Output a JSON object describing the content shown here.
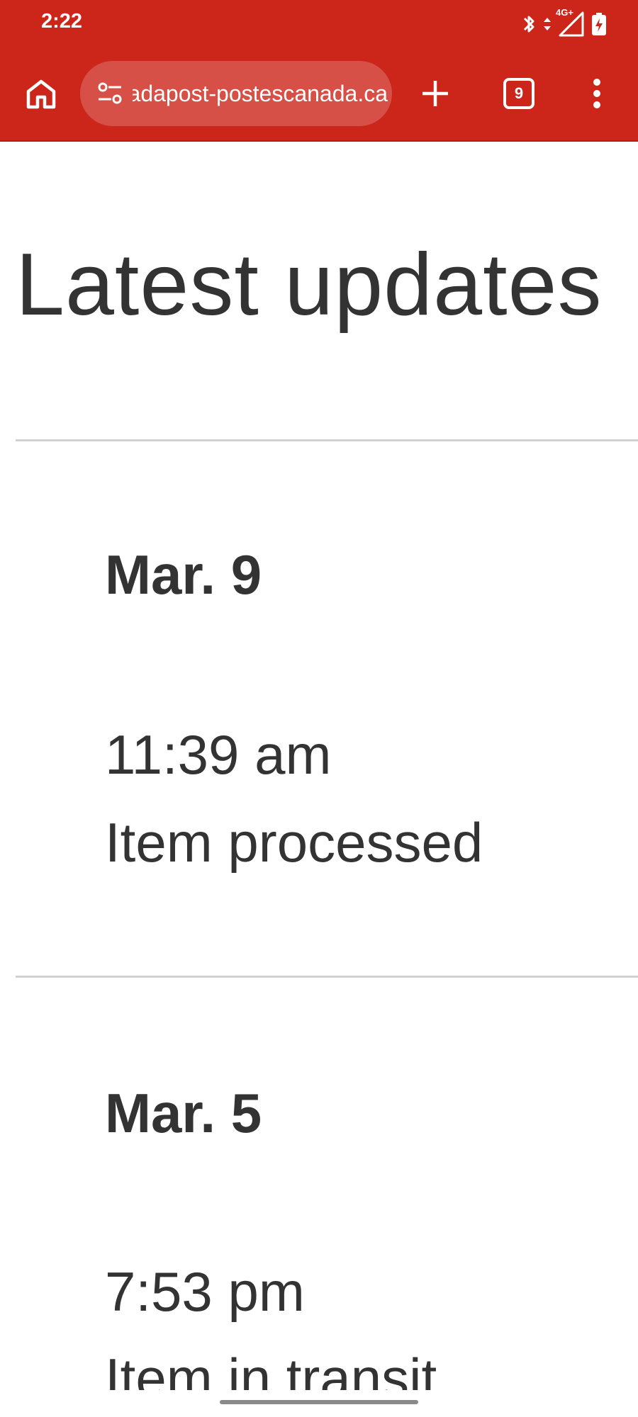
{
  "status_bar": {
    "time": "2:22",
    "network_label": "4G+",
    "icons": [
      "bluetooth-icon",
      "data-arrows-icon",
      "signal-icon",
      "battery-charging-icon"
    ]
  },
  "browser": {
    "url": "canadapost-postescanada.ca",
    "tab_count": "9",
    "accent_color": "#cc251a",
    "icons": [
      "home-icon",
      "site-settings-icon",
      "plus-icon",
      "tabs-icon",
      "more-vert-icon"
    ]
  },
  "page": {
    "heading": "Latest updates",
    "updates": [
      {
        "date": "Mar. 9",
        "time": "11:39 am",
        "description": "Item processed"
      },
      {
        "date": "Mar. 5",
        "time": "7:53 pm",
        "description": "Item in transit"
      }
    ]
  }
}
